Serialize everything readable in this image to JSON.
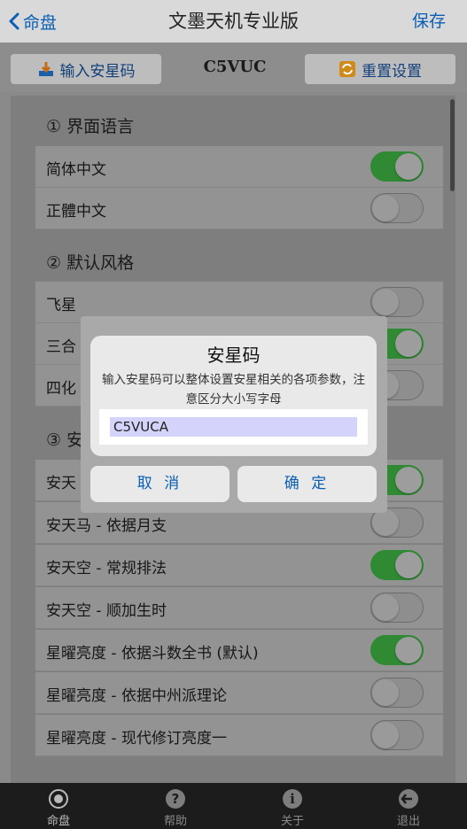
{
  "nav": {
    "back_label": "命盘",
    "title": "文墨天机专业版",
    "save_label": "保存"
  },
  "toolbar": {
    "input_code_label": "输入安星码",
    "current_code": "C5VUC",
    "reset_label": "重置设置"
  },
  "sections": [
    {
      "title": "① 界面语言",
      "items": [
        {
          "label": "简体中文",
          "on": true
        },
        {
          "label": "正體中文",
          "on": false
        }
      ]
    },
    {
      "title": "② 默认风格",
      "items": [
        {
          "label": "飞星",
          "on": false
        },
        {
          "label": "三合",
          "on": true
        },
        {
          "label": "四化",
          "on": false
        }
      ]
    },
    {
      "title": "③ 安",
      "items": [
        {
          "label": "安天",
          "on": true
        },
        {
          "label": "安天马 - 依据月支",
          "on": false
        },
        {
          "label": "安天空 - 常规排法",
          "on": true
        },
        {
          "label": "安天空 - 顺加生时",
          "on": false
        },
        {
          "label": "星曜亮度 - 依据斗数全书 (默认)",
          "on": true
        },
        {
          "label": "星曜亮度 - 依据中州派理论",
          "on": false
        },
        {
          "label": "星曜亮度 - 现代修订亮度一",
          "on": false
        }
      ]
    }
  ],
  "dialog": {
    "title": "安星码",
    "message": "输入安星码可以整体设置安星相关的各项参数，注意区分大小写字母",
    "input_value": "C5VUCA",
    "cancel_label": "取 消",
    "ok_label": "确 定"
  },
  "tabbar": {
    "tabs": [
      {
        "label": "命盘",
        "icon": "chart-icon"
      },
      {
        "label": "帮助",
        "icon": "help-icon"
      },
      {
        "label": "关于",
        "icon": "info-icon"
      },
      {
        "label": "退出",
        "icon": "exit-icon"
      }
    ]
  },
  "colors": {
    "accent": "#0a5fb4",
    "toggle_on": "#2f8a33"
  }
}
